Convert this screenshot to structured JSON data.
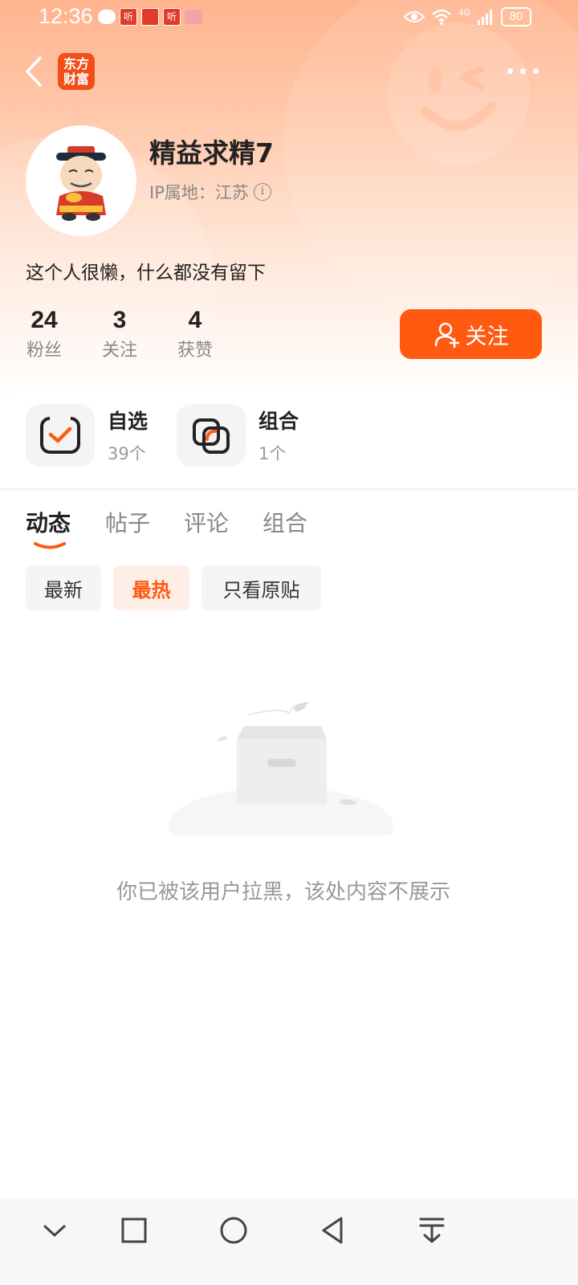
{
  "status_bar": {
    "time": "12:36",
    "notification_icons": [
      "chat-bubble-icon",
      "app-ting-icon",
      "app-red-icon",
      "app-ting-icon",
      "app-pink-icon"
    ],
    "app_badge_text": "听",
    "network": "4G",
    "battery": "80"
  },
  "header": {
    "app_logo_text": "东方财富",
    "logo_color": "#f24e18"
  },
  "profile": {
    "username": "精益求精7",
    "ip_location": "IP属地：江苏",
    "bio": "这个人很懒，什么都没有留下",
    "stats": [
      {
        "value": "24",
        "label": "粉丝"
      },
      {
        "value": "3",
        "label": "关注"
      },
      {
        "value": "4",
        "label": "获赞"
      }
    ],
    "follow_button": "关注"
  },
  "shortcuts": [
    {
      "title": "自选",
      "subtitle": "39个",
      "icon": "checkbox-icon"
    },
    {
      "title": "组合",
      "subtitle": "1个",
      "icon": "overlap-squares-icon"
    }
  ],
  "tabs": [
    {
      "label": "动态",
      "active": true
    },
    {
      "label": "帖子",
      "active": false
    },
    {
      "label": "评论",
      "active": false
    },
    {
      "label": "组合",
      "active": false
    }
  ],
  "filters": [
    {
      "label": "最新",
      "active": false
    },
    {
      "label": "最热",
      "active": true
    },
    {
      "label": "只看原贴",
      "active": false
    }
  ],
  "empty_state": {
    "message": "你已被该用户拉黑，该处内容不展示",
    "icon": "empty-box-icon"
  },
  "system_nav": [
    "chevron-down-icon",
    "square-icon",
    "circle-icon",
    "back-triangle-icon",
    "download-icon"
  ],
  "colors": {
    "accent": "#ff5a10",
    "header_gradient_top": "#ffb48e"
  }
}
